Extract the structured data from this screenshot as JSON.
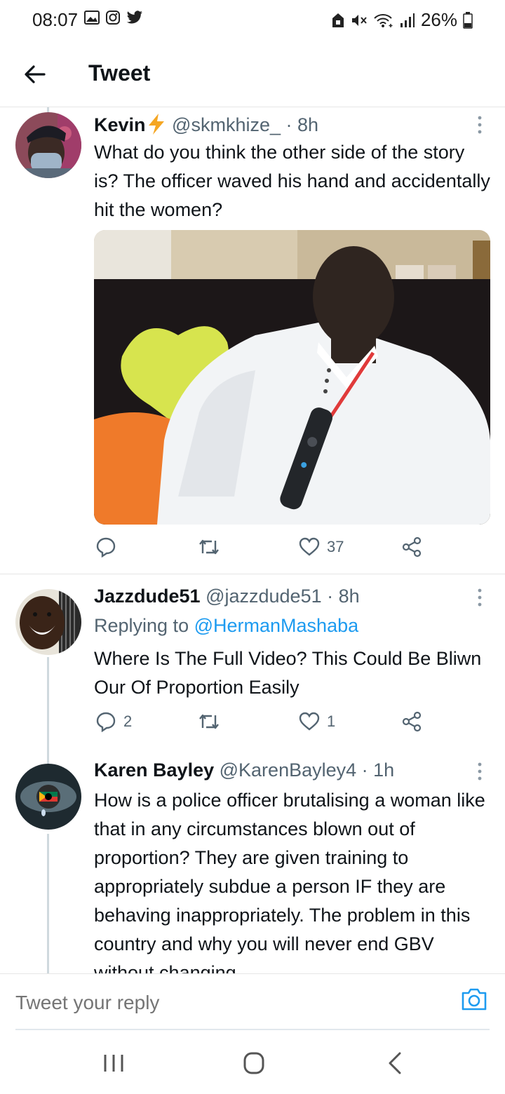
{
  "status_bar": {
    "time": "08:07",
    "battery": "26%"
  },
  "header": {
    "title": "Tweet"
  },
  "tweets": [
    {
      "name": "Kevin",
      "handle": "@skmkhize_",
      "time": "· 8h",
      "text": "What do you think the other side of the story is? The officer waved his hand and accidentally hit the women?",
      "replies": "",
      "retweets": "",
      "likes": "37"
    },
    {
      "name": "Jazzdude51",
      "handle": "@jazzdude51",
      "time": "· 8h",
      "replying_prefix": "Replying to",
      "replying_to": "@HermanMashaba",
      "text": "Where Is The Full Video? This Could Be Bliwn Our Of Proportion Easily",
      "replies": "2",
      "retweets": "",
      "likes": "1"
    },
    {
      "name": "Karen Bayley",
      "handle": "@KarenBayley4",
      "time": "· 1h",
      "text": "How is a police officer brutalising a woman like that in any circumstances blown out of proportion? They are given training to appropriately subdue a person IF they are behaving inappropriately. The problem in this country and why you will never end GBV without changing"
    }
  ],
  "reply_bar": {
    "placeholder": "Tweet your reply"
  },
  "colors": {
    "accent": "#1d9bf0",
    "muted": "#536471",
    "text": "#0f1419"
  }
}
